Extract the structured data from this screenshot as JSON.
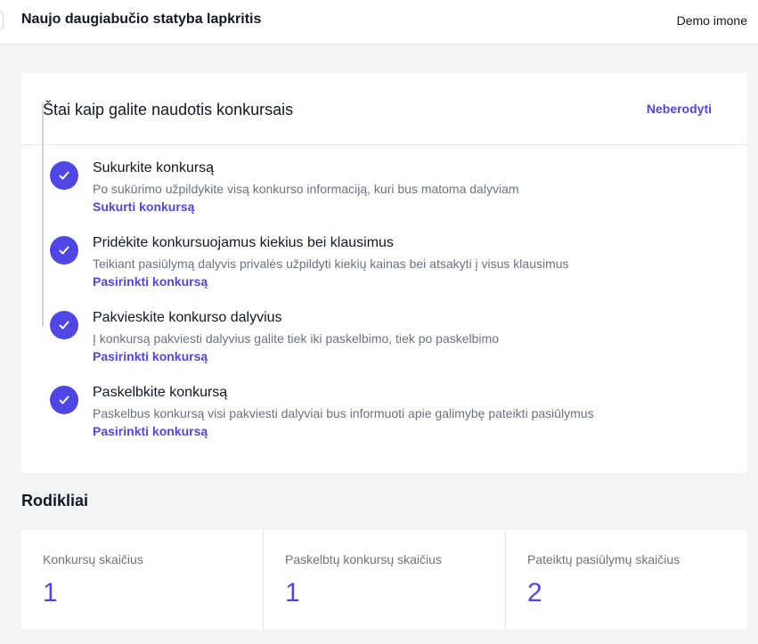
{
  "header": {
    "project_title": "Naujo daugiabučio statyba lapkritis",
    "company": "Demo imone"
  },
  "guide": {
    "title": "Štai kaip galite naudotis konkursais",
    "dismiss_label": "Neberodyti",
    "steps": [
      {
        "title": "Sukurkite konkursą",
        "description": "Po sukūrimo užpildykite visą konkurso informaciją, kuri bus matoma dalyviam",
        "link": "Sukurti konkursą",
        "done": true
      },
      {
        "title": "Pridėkite konkursuojamus kiekius bei klausimus",
        "description": "Teikiant pasiūlymą dalyvis privalės užpildyti kiekių kainas bei atsakyti į visus klausimus",
        "link": "Pasirinkti konkursą",
        "done": true
      },
      {
        "title": "Pakvieskite konkurso dalyvius",
        "description": "Į konkursą pakviesti dalyvius galite tiek iki paskelbimo, tiek po paskelbimo",
        "link": "Pasirinkti konkursą",
        "done": true
      },
      {
        "title": "Paskelbkite konkursą",
        "description": "Paskelbus konkursą visi pakviesti dalyviai bus informuoti apie galimybę pateikti pasiūlymus",
        "link": "Pasirinkti konkursą",
        "done": true
      }
    ]
  },
  "stats": {
    "title": "Rodikliai",
    "items": [
      {
        "label": "Konkursų skaičius",
        "value": "1"
      },
      {
        "label": "Paskelbtų konkursų skaičius",
        "value": "1"
      },
      {
        "label": "Pateiktų pasiūlymų skaičius",
        "value": "2"
      }
    ]
  },
  "colors": {
    "accent": "#4f46e5",
    "background": "#f3f4f6",
    "muted_text": "#6b7280"
  }
}
